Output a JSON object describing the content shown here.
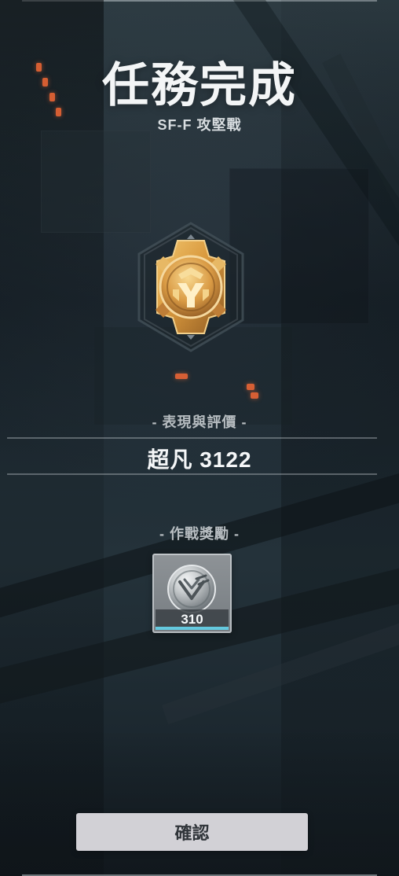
{
  "header": {
    "title": "任務完成",
    "subtitle": "SF-F 攻堅戰"
  },
  "medal": {
    "icon": "gold-medal-icon",
    "accent": "#d8a047"
  },
  "performance": {
    "label": "- 表現與評價 -",
    "score_text": "超凡 3122"
  },
  "rewards": {
    "label": "- 作戰獎勵 -",
    "items": [
      {
        "icon": "silver-coin-icon",
        "count": "310"
      }
    ]
  },
  "actions": {
    "confirm_label": "確認"
  },
  "colors": {
    "background": "#1f2a31",
    "button_bg": "#d2d1d6",
    "reward_accent": "#64c9df"
  }
}
